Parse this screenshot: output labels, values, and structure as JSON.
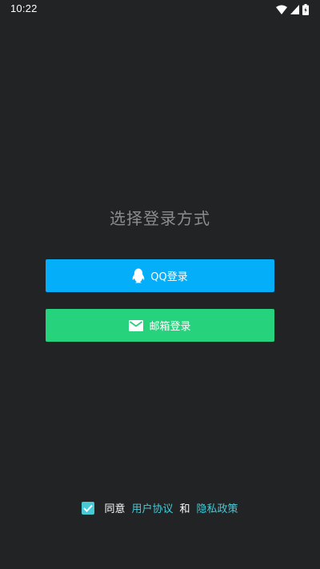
{
  "status_bar": {
    "time": "10:22",
    "icons": [
      "wifi-icon",
      "signal-icon",
      "battery-icon"
    ]
  },
  "title": "选择登录方式",
  "buttons": {
    "qq": {
      "label": "QQ登录",
      "icon": "qq-penguin-icon",
      "color": "#04aef8"
    },
    "email": {
      "label": "邮箱登录",
      "icon": "mail-icon",
      "color": "#27d27c"
    }
  },
  "agreement": {
    "checked": true,
    "prefix": "同意",
    "user_agreement": "用户协议",
    "conjunction": "和",
    "privacy_policy": "隐私政策",
    "link_color": "#47c9d6"
  },
  "colors": {
    "background": "#222325",
    "title_text": "#8b8c8e"
  }
}
